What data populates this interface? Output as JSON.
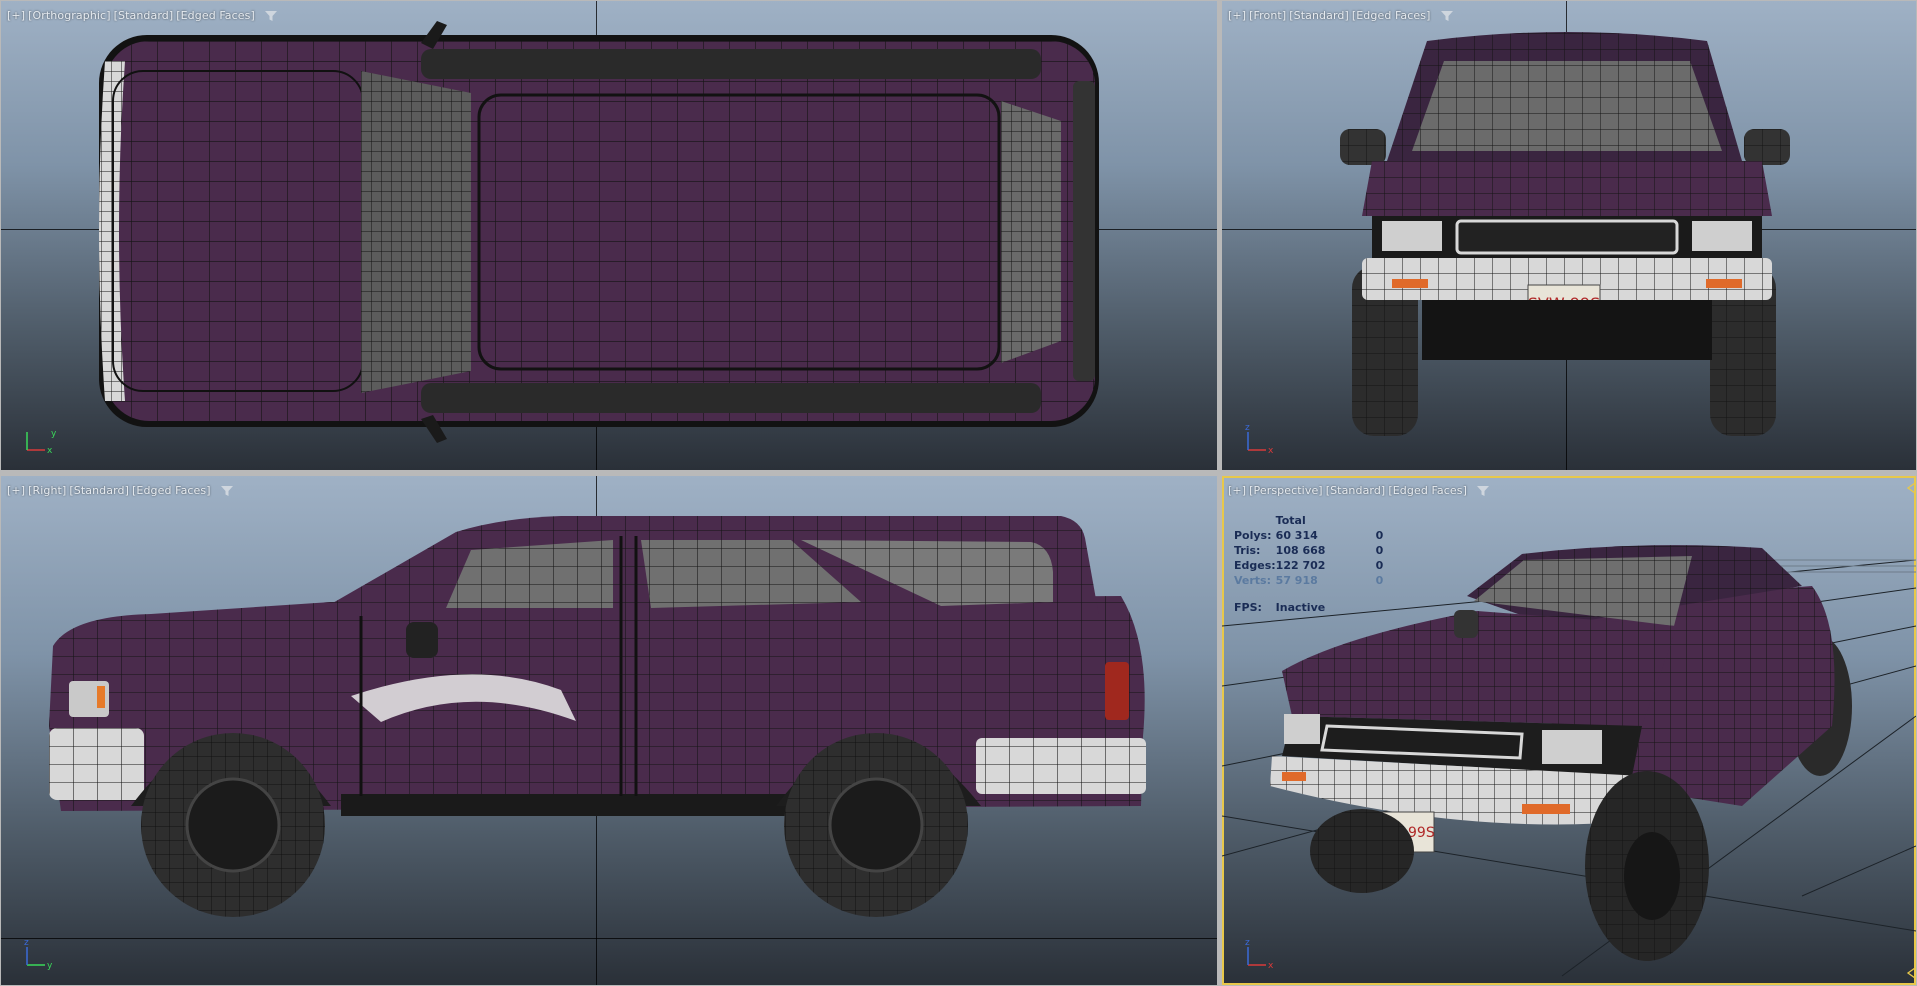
{
  "viewports": {
    "top_left": {
      "plus": "[+]",
      "view": "[Orthographic]",
      "shading": "[Standard]",
      "mode": "[Edged Faces]",
      "gizmo_axes": [
        "x",
        "y"
      ]
    },
    "top_right": {
      "plus": "[+]",
      "view": "[Front]",
      "shading": "[Standard]",
      "mode": "[Edged Faces]",
      "gizmo_axes": [
        "x",
        "z"
      ]
    },
    "bottom_left": {
      "plus": "[+]",
      "view": "[Right]",
      "shading": "[Standard]",
      "mode": "[Edged Faces]",
      "gizmo_axes": [
        "y",
        "z"
      ]
    },
    "bottom_right": {
      "plus": "[+]",
      "view": "[Perspective]",
      "shading": "[Standard]",
      "mode": "[Edged Faces]",
      "gizmo_axes": [
        "x",
        "z"
      ]
    }
  },
  "stats": {
    "header": "Total",
    "rows": [
      {
        "label": "Polys:",
        "total": "60 314",
        "selected": "0"
      },
      {
        "label": "Tris:",
        "total": "108 668",
        "selected": "0"
      },
      {
        "label": "Edges:",
        "total": "122 702",
        "selected": "0"
      },
      {
        "label": "Verts:",
        "total": "57 918",
        "selected": "0"
      }
    ],
    "fps_label": "FPS:",
    "fps_value": "Inactive"
  },
  "license_plate": "SVW 99S",
  "colors": {
    "body_purple": "#4a2b4c",
    "wire_dark": "#141414",
    "viewport_top": "#9fb1c5",
    "viewport_bottom": "#2a3038",
    "active_border": "#e8c84a",
    "stats_text": "#1a2c55"
  },
  "icons": {
    "filter": "funnel-icon",
    "axis": "axis-gizmo-icon"
  }
}
